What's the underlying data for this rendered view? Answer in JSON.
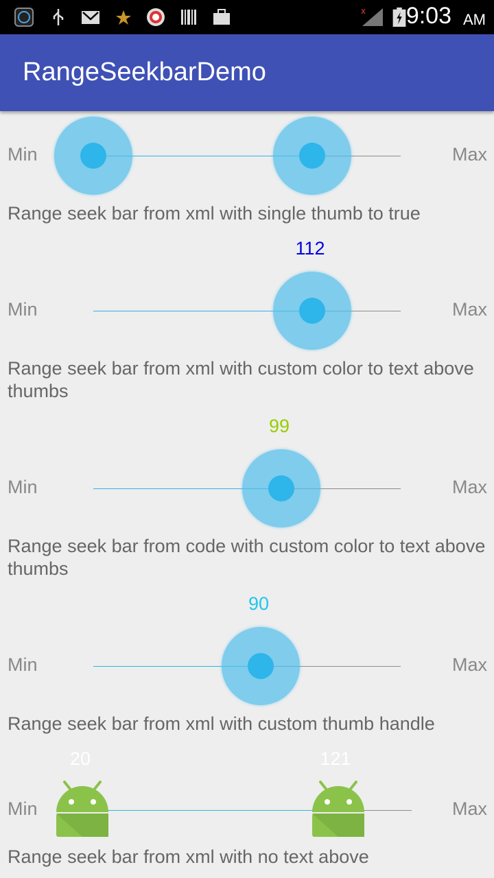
{
  "status_bar": {
    "time": "9:03",
    "ampm": "AM",
    "icons": [
      "app-icon",
      "usb-icon",
      "gmail-icon",
      "star-icon",
      "face-icon",
      "barcode-icon",
      "briefcase-icon",
      "signal-icon",
      "battery-icon"
    ]
  },
  "app_bar": {
    "title": "RangeSeekbarDemo"
  },
  "colors": {
    "primary": "#3f51b5",
    "thumb": "#2eb5ea",
    "value_blue": "#0000e6",
    "value_green": "#99cc00",
    "value_cyan": "#1ec8f0",
    "value_white": "#ffffff"
  },
  "bars": [
    {
      "min_label": "Min",
      "max_label": "Max",
      "caption": "Range seek bar from xml with single thumb to true"
    },
    {
      "min_label": "Min",
      "max_label": "Max",
      "value": "112",
      "caption": "Range seek bar from xml with custom color to text above thumbs"
    },
    {
      "min_label": "Min",
      "max_label": "Max",
      "value": "99",
      "caption": "Range seek bar from code with custom color to text above thumbs"
    },
    {
      "min_label": "Min",
      "max_label": "Max",
      "value": "90",
      "caption": "Range seek bar from xml with custom thumb handle"
    },
    {
      "min_label": "Min",
      "max_label": "Max",
      "value_low": "20",
      "value_high": "121",
      "caption": "Range seek bar from xml with no text above"
    }
  ]
}
